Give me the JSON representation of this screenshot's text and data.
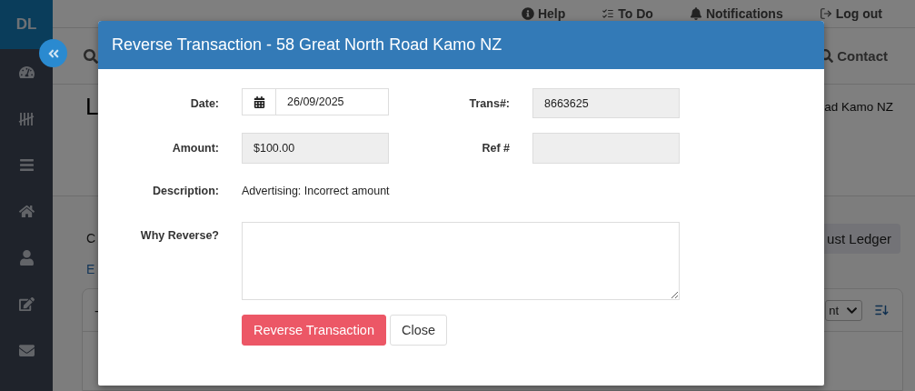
{
  "sidebar": {
    "logo": "DL"
  },
  "top_nav": [
    {
      "label": "Help"
    },
    {
      "label": "To Do"
    },
    {
      "label": "Notifications"
    },
    {
      "label": "Log out"
    }
  ],
  "search_bar": {
    "contact_label": "Contact"
  },
  "page": {
    "title": "L",
    "address": "ad Kamo NZ",
    "line_1": "C",
    "line_2": "E",
    "ledger_button": "ust Ledger",
    "card": {
      "header_text": "-",
      "sort_select": "nt"
    }
  },
  "dialog": {
    "title": "Reverse Transaction - 58 Great North Road Kamo NZ",
    "date": {
      "label": "Date:",
      "value": "26/09/2025"
    },
    "trans": {
      "label": "Trans#:",
      "value": "8663625"
    },
    "amount": {
      "label": "Amount:",
      "value": "$100.00"
    },
    "ref": {
      "label": "Ref #"
    },
    "description": {
      "label": "Description:",
      "value": "Advertising: Incorrect amount"
    },
    "reason": {
      "label": "Why Reverse?"
    },
    "buttons": [
      {
        "label": "Reverse Transaction",
        "kind": "danger"
      },
      {
        "label": "Close",
        "kind": "default"
      }
    ]
  }
}
